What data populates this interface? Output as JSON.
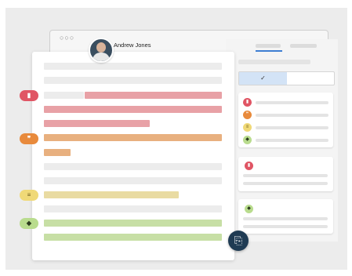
{
  "window": {
    "dots_label": "○○○",
    "user_name": "Andrew Jones"
  },
  "review_panel": {
    "segmented_checked_label": "✓"
  },
  "tags": {
    "evidence": {
      "icon": "clipboard-icon",
      "color": "#e05564",
      "glyph": "▮"
    },
    "quote": {
      "icon": "quote-icon",
      "color": "#e88a3c",
      "glyph": "❞"
    },
    "notes": {
      "icon": "notes-icon",
      "color": "#f0d977",
      "glyph": "≡"
    },
    "education": {
      "icon": "graduation-cap-icon",
      "color": "#b9dc8e",
      "glyph": "◆"
    }
  },
  "fab": {
    "glyph": "⎘",
    "icon": "export-icon"
  },
  "colors": {
    "accent_blue": "#3e7ed2",
    "red_highlight": "#e8a1a6",
    "orange_highlight": "#e8b07f",
    "yellow_highlight": "#e9dba2",
    "green_highlight": "#c7dfa5"
  }
}
